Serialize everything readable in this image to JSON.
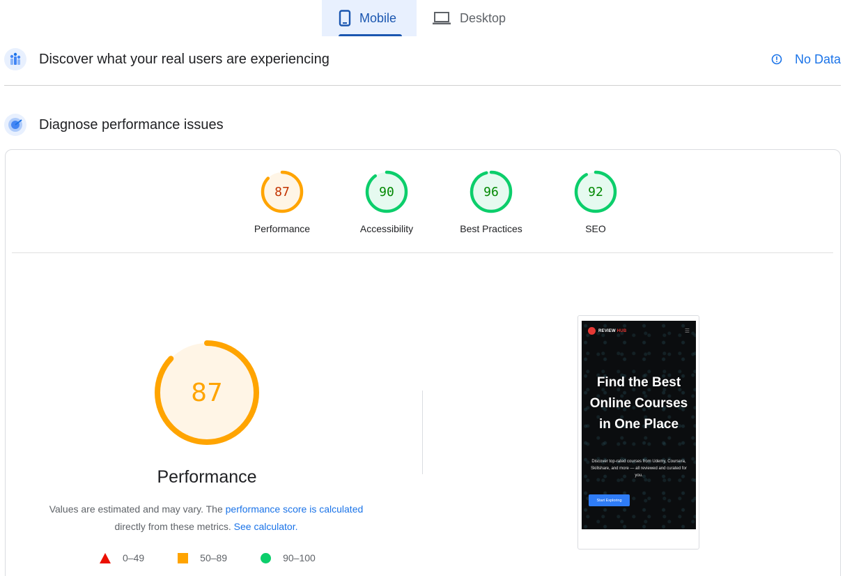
{
  "tabs": [
    {
      "label": "Mobile",
      "icon": "smartphone-icon",
      "selected": true
    },
    {
      "label": "Desktop",
      "icon": "laptop-icon",
      "selected": false
    }
  ],
  "field_data": {
    "title": "Discover what your real users are experiencing",
    "status": "No Data",
    "status_icon": "info-icon"
  },
  "lab_data": {
    "title": "Diagnose performance issues"
  },
  "colors": {
    "average": "#ffa400",
    "pass": "#0cce6b",
    "fail": "#ff4e42",
    "link": "#1a73e8"
  },
  "scores": [
    {
      "label": "Performance",
      "value": 87
    },
    {
      "label": "Accessibility",
      "value": 90
    },
    {
      "label": "Best Practices",
      "value": 96
    },
    {
      "label": "SEO",
      "value": 92
    }
  ],
  "performance": {
    "score": 87,
    "label": "Performance",
    "desc_prefix": "Values are estimated and may vary. The ",
    "desc_link1": "performance score is calculated",
    "desc_middle": " directly from these metrics. ",
    "desc_link2": "See calculator."
  },
  "legend": [
    {
      "shape": "triangle",
      "range": "0–49"
    },
    {
      "shape": "square",
      "range": "50–89"
    },
    {
      "shape": "circle",
      "range": "90–100"
    }
  ],
  "preview": {
    "brand_prefix": "REVIEW ",
    "brand_suffix": "HUB",
    "heading": "Find the Best Online Courses in One Place",
    "paragraph": "Discover top-rated courses from Udemy, Coursera, Skillshare, and more — all reviewed and curated for you.",
    "button": "Start Exploring"
  }
}
